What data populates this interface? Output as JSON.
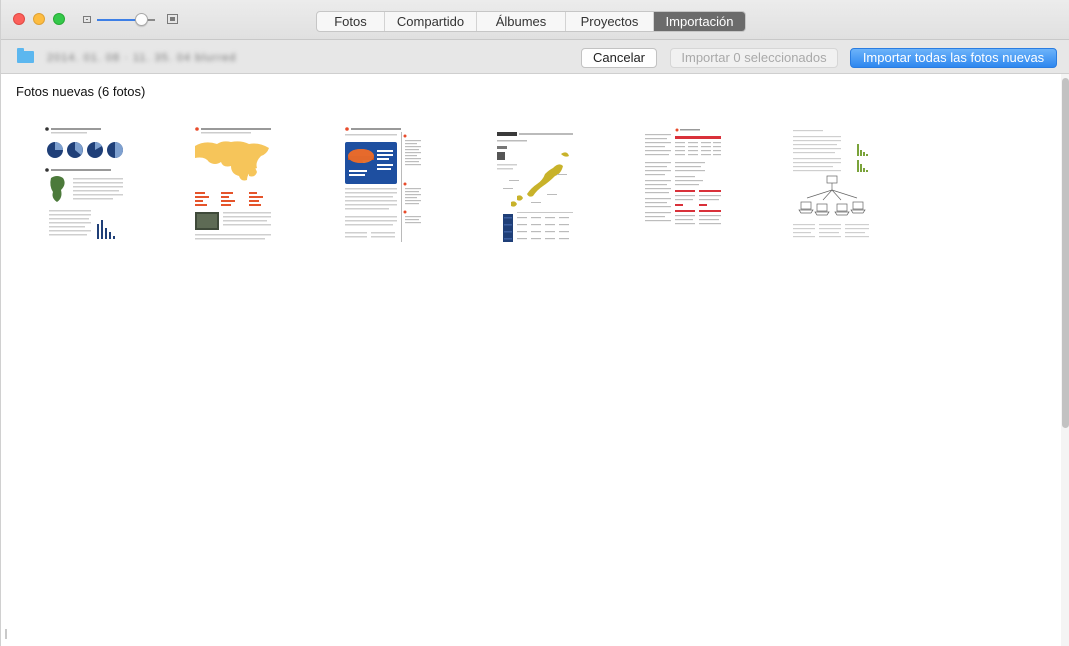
{
  "window": {
    "traffic_lights": [
      "close",
      "minimize",
      "zoom"
    ],
    "zoom_level": 0.72
  },
  "tabs": [
    {
      "label": "Fotos",
      "selected": false
    },
    {
      "label": "Compartido",
      "selected": false
    },
    {
      "label": "Álbumes",
      "selected": false
    },
    {
      "label": "Proyectos",
      "selected": false
    },
    {
      "label": "Importación",
      "selected": true
    }
  ],
  "import_bar": {
    "device_icon": "folder-icon",
    "device_name": "2014. 01. 08 · 11. 35. 04 blurred",
    "cancel_label": "Cancelar",
    "import_selected_label": "Importar 0 seleccionados",
    "import_all_label": "Importar todas las fotos nuevas"
  },
  "content": {
    "section_title": "Fotos nuevas (6 fotos)",
    "thumbnails": [
      {
        "kind": "document-page-pie-charts"
      },
      {
        "kind": "document-page-world-map"
      },
      {
        "kind": "document-page-3d-pie"
      },
      {
        "kind": "document-page-japan-map"
      },
      {
        "kind": "document-page-table"
      },
      {
        "kind": "document-page-network-diagram"
      }
    ]
  },
  "colors": {
    "accent": "#2e87ef",
    "selected_tab": "#6b6b6b",
    "close": "#fc605b",
    "minimize": "#fdbc40",
    "zoom": "#34c84a",
    "folder": "#5cb7ef"
  }
}
